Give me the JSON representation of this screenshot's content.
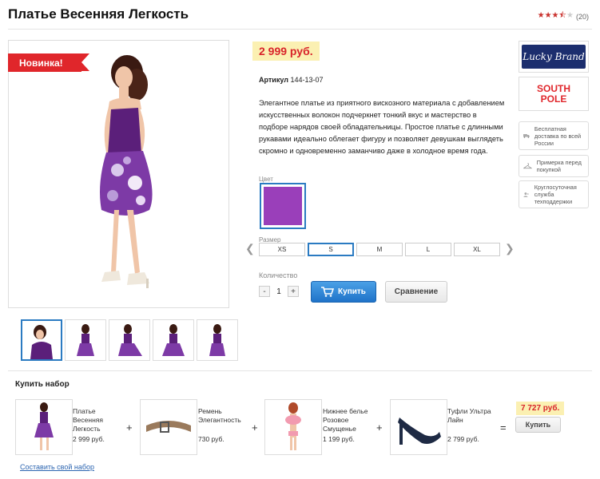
{
  "product": {
    "title": "Платье Весенняя Легкость",
    "rating_count": "(20)",
    "badge": "Новинка!",
    "price": "2 999 руб.",
    "sku_label": "Артикул",
    "sku_value": "144-13-07",
    "description": "Элегантное платье из приятного вискозного материала с добавлением искусственных волокон подчеркнет тонкий вкус и мастерство в подборе нарядов своей обладательницы. Простое платье с длинными рукавами идеально облегает фигуру и позволяет девушкам выглядеть скромно и одновременно заманчиво даже в холодное время года."
  },
  "rating": {
    "value": 3.5,
    "max": 5
  },
  "options": {
    "color_label": "Цвет",
    "color_hex": "#9a3fba",
    "size_label": "Размер",
    "sizes": [
      "XS",
      "S",
      "M",
      "L",
      "XL"
    ],
    "selected_size": "S",
    "quantity_label": "Количество",
    "quantity": "1",
    "minus": "-",
    "plus": "+"
  },
  "actions": {
    "buy": "Купить",
    "compare": "Сравнение"
  },
  "brands": {
    "lucky": "Lucky Brand",
    "south": "SOUTH POLE"
  },
  "features": [
    {
      "icon": "truck-icon",
      "text": "Бесплатная доставка по всей России"
    },
    {
      "icon": "hanger-icon",
      "text": "Примерка перед покупкой"
    },
    {
      "icon": "support-icon",
      "text": "Круглосуточная служба техподдержки"
    }
  ],
  "set": {
    "title": "Купить набор",
    "items": [
      {
        "name": "Платье Весенняя Легкость",
        "price": "2 999 руб."
      },
      {
        "name": "Ремень Элегантность",
        "price": "730 руб."
      },
      {
        "name": "Нижнее белье Розовое Смущенье",
        "price": "1 199 руб."
      },
      {
        "name": "Туфли Ультра Лайн",
        "price": "2 799 руб."
      }
    ],
    "plus": "+",
    "equals": "=",
    "total": "7 727 руб.",
    "buy": "Купить",
    "build_link": "Составить свой набор"
  },
  "colors": {
    "accent_blue": "#2b7bc2",
    "price_red": "#d8232a",
    "price_bg": "#fbf0b2",
    "badge_red": "#e0262b"
  }
}
